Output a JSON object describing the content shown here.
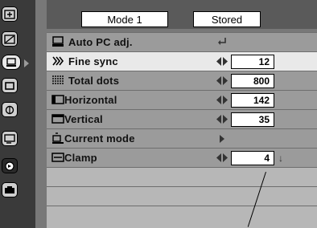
{
  "header": {
    "mode_label": "Mode 1",
    "stored_label": "Stored"
  },
  "tabs": [
    {
      "name": "input-icon"
    },
    {
      "name": "image-adjust-icon"
    },
    {
      "name": "pc-adjust-icon",
      "active": true
    },
    {
      "name": "screen-icon"
    },
    {
      "name": "color-icon"
    },
    {
      "name": "setting-icon"
    },
    {
      "name": "sound-icon"
    },
    {
      "name": "lamp-icon"
    }
  ],
  "rows": [
    {
      "label": "Auto PC adj.",
      "control": "enter"
    },
    {
      "label": "Fine sync",
      "value": "12",
      "control": "adjust",
      "selected": true
    },
    {
      "label": "Total dots",
      "value": "800",
      "control": "adjust"
    },
    {
      "label": "Horizontal",
      "value": "142",
      "control": "adjust"
    },
    {
      "label": "Vertical",
      "value": "35",
      "control": "adjust"
    },
    {
      "label": "Current mode",
      "control": "submenu"
    },
    {
      "label": "Clamp",
      "value": "4",
      "control": "adjust"
    }
  ]
}
